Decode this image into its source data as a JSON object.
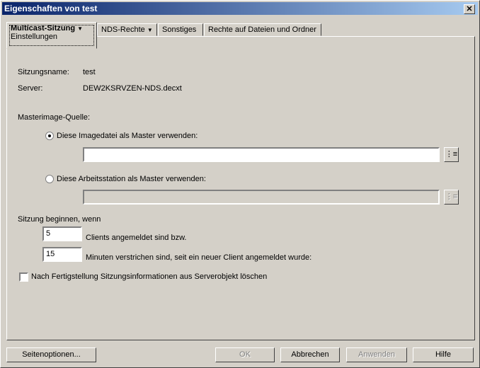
{
  "window": {
    "title": "Eigenschaften von test",
    "close": "✕"
  },
  "tabs": [
    {
      "label": "Multicast-Sitzung",
      "sub": "Einstellungen"
    },
    {
      "label": "NDS-Rechte"
    },
    {
      "label": "Sonstiges"
    },
    {
      "label": "Rechte auf Dateien und Ordner"
    }
  ],
  "dropdown_glyph": "▼",
  "fields": {
    "session_label": "Sitzungsname:",
    "session_value": "test",
    "server_label": "Server:",
    "server_value": "DEW2KSRVZEN-NDS.decxt"
  },
  "master": {
    "heading": "Masterimage-Quelle:",
    "opt1": "Diese Imagedatei als Master verwenden:",
    "opt1_value": "",
    "opt2": "Diese Arbeitsstation als Master verwenden:",
    "opt2_value": "",
    "browse": "⋮≡"
  },
  "start": {
    "heading": "Sitzung beginnen, wenn",
    "clients_value": "5",
    "clients_label": "Clients angemeldet sind bzw.",
    "minutes_value": "15",
    "minutes_label": "Minuten verstrichen sind, seit ein neuer Client angemeldet wurde:"
  },
  "delete_checkbox": {
    "label": "Nach Fertigstellung Sitzungsinformationen aus Serverobjekt löschen",
    "checked": false
  },
  "buttons": {
    "page_options": "Seitenoptionen...",
    "ok": "OK",
    "cancel": "Abbrechen",
    "apply": "Anwenden",
    "help": "Hilfe"
  }
}
